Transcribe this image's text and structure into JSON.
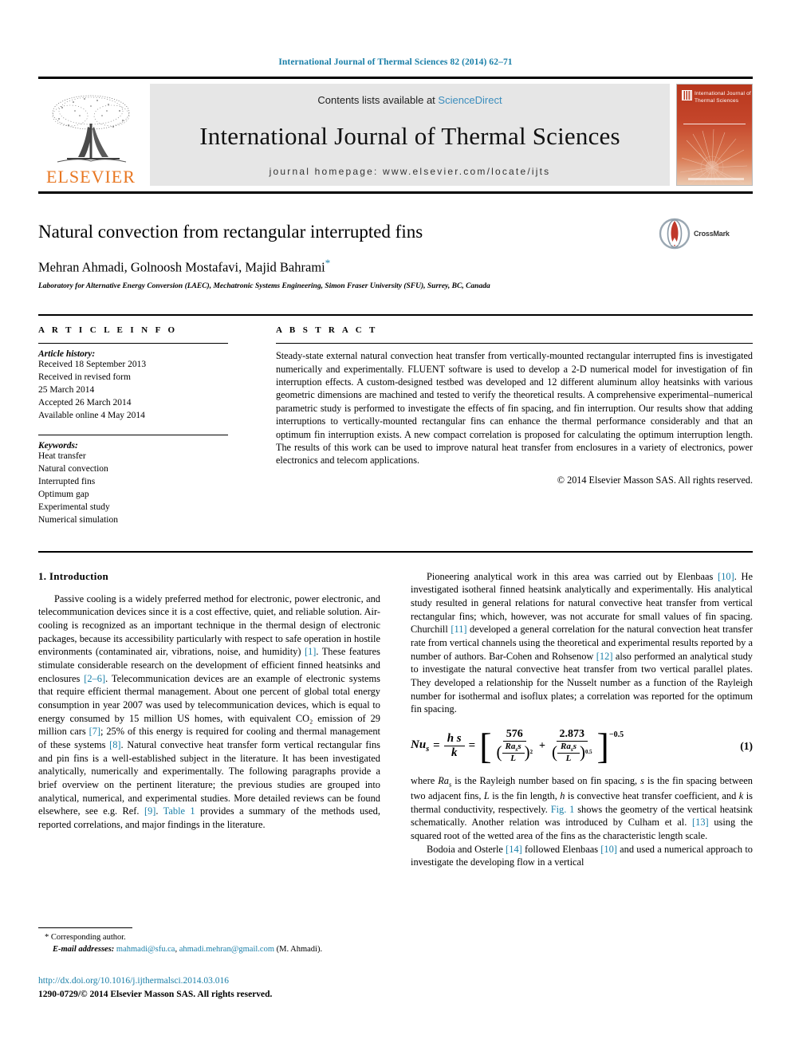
{
  "running_head": "International Journal of Thermal Sciences 82 (2014) 62–71",
  "masthead": {
    "contents_prefix": "Contents lists available at ",
    "sciencedirect": "ScienceDirect",
    "journal_name": "International Journal of Thermal Sciences",
    "homepage": "journal homepage: www.elsevier.com/locate/ijts",
    "publisher_logo_text": "ELSEVIER",
    "cover_title": "International Journal of Thermal Sciences",
    "accent_color": "#1a7fa8",
    "elsevier_orange": "#E87722",
    "cover_red": "#b8371d"
  },
  "title_block": {
    "title": "Natural convection from rectangular interrupted fins",
    "authors": "Mehran Ahmadi, Golnoosh Mostafavi, Majid Bahrami",
    "corresponding_marker": "*",
    "affiliation": "Laboratory for Alternative Energy Conversion (LAEC), Mechatronic Systems Engineering, Simon Fraser University (SFU), Surrey, BC, Canada",
    "crossmark_label": "CrossMark"
  },
  "article_info": {
    "heading": "A R T I C L E   I N F O",
    "history_label": "Article history:",
    "history": [
      "Received 18 September 2013",
      "Received in revised form",
      "25 March 2014",
      "Accepted 26 March 2014",
      "Available online 4 May 2014"
    ],
    "keywords_label": "Keywords:",
    "keywords": [
      "Heat transfer",
      "Natural convection",
      "Interrupted fins",
      "Optimum gap",
      "Experimental study",
      "Numerical simulation"
    ]
  },
  "abstract": {
    "heading": "A B S T R A C T",
    "text": "Steady-state external natural convection heat transfer from vertically-mounted rectangular interrupted fins is investigated numerically and experimentally. FLUENT software is used to develop a 2-D numerical model for investigation of fin interruption effects. A custom-designed testbed was developed and 12 different aluminum alloy heatsinks with various geometric dimensions are machined and tested to verify the theoretical results. A comprehensive experimental–numerical parametric study is performed to investigate the effects of fin spacing, and fin interruption. Our results show that adding interruptions to vertically-mounted rectangular fins can enhance the thermal performance considerably and that an optimum fin interruption exists. A new compact correlation is proposed for calculating the optimum interruption length. The results of this work can be used to improve natural heat transfer from enclosures in a variety of electronics, power electronics and telecom applications.",
    "copyright": "© 2014 Elsevier Masson SAS. All rights reserved."
  },
  "body": {
    "section_number_title": "1. Introduction",
    "left_paragraph_1_a": "Passive cooling is a widely preferred method for electronic, power electronic, and telecommunication devices since it is a cost effective, quiet, and reliable solution. Air-cooling is recognized as an important technique in the thermal design of electronic packages, because its accessibility particularly with respect to safe operation in hostile environments (contaminated air, vibrations, noise, and humidity) ",
    "ref_1": "[1]",
    "left_paragraph_1_b": ". These features stimulate considerable research on the development of efficient finned heatsinks and enclosures ",
    "ref_2_6": "[2–6]",
    "left_paragraph_1_c": ". Telecommunication devices are an example of electronic systems that require efficient thermal management. About one percent of global total energy consumption in year 2007 was used by telecommunication devices, which is equal to energy consumed by 15 million US homes, with equivalent CO₂ emission of 29 million cars ",
    "ref_7": "[7]",
    "left_paragraph_1_d": "; 25% of this energy is required for cooling and thermal management of these systems ",
    "ref_8": "[8]",
    "left_paragraph_1_e": ". Natural convective heat transfer form vertical rectangular fins and pin fins is a well-established subject in the literature. It has been investigated analytically, numerically and experimentally. The following paragraphs provide a brief overview on the pertinent literature; the previous studies are grouped into analytical, numerical, and experimental studies. More detailed reviews can be found elsewhere, see e.g. Ref. ",
    "ref_9": "[9]",
    "left_paragraph_1_f": ". ",
    "table_1_link": "Table 1",
    "left_paragraph_1_g": " provides a summary of the methods used, reported correlations, and major findings in the literature.",
    "right_paragraph_1_a": "Pioneering analytical work in this area was carried out by Elenbaas ",
    "ref_10": "[10]",
    "right_paragraph_1_b": ". He investigated isotheral finned heatsink analytically and experimentally. His analytical study resulted in general relations for natural convective heat transfer from vertical rectangular fins; which, however, was not accurate for small values of fin spacing. Churchill ",
    "ref_11": "[11]",
    "right_paragraph_1_c": " developed a general correlation for the natural convection heat transfer rate from vertical channels using the theoretical and experimental results reported by a number of authors. Bar-Cohen and Rohsenow ",
    "ref_12": "[12]",
    "right_paragraph_1_d": " also performed an analytical study to investigate the natural convective heat transfer from two vertical parallel plates. They developed a relationship for the Nusselt number as a function of the Rayleigh number for isothermal and isoflux plates; a correlation was reported for the optimum fin spacing.",
    "equation": {
      "lhs_symbol": "Nu",
      "lhs_sub": "s",
      "eq1": "=",
      "frac1_num": "h s",
      "frac1_den": "k",
      "eq2": "=",
      "term1_num": "576",
      "term1_den_paren_num": "Ra",
      "term1_den_paren_sub": "s",
      "term1_den_paren_num2": "s",
      "term1_den_paren_den": "L",
      "term1_den_exp": "2",
      "plus": "+",
      "term2_num": "2.873",
      "term2_den_paren_num": "Ra",
      "term2_den_paren_sub": "s",
      "term2_den_paren_num2": "s",
      "term2_den_paren_den": "L",
      "term2_den_exp": "0.5",
      "outer_exp": "−0.5",
      "number": "(1)"
    },
    "right_paragraph_2_a": "where ",
    "ra_s": "Ra",
    "ra_s_sub": "s",
    "right_paragraph_2_b": " is the Rayleigh number based on fin spacing, ",
    "sym_s": "s",
    "right_paragraph_2_c": " is the fin spacing between two adjacent fins, ",
    "sym_L": "L",
    "right_paragraph_2_d": " is the fin length, ",
    "sym_h": "h",
    "right_paragraph_2_e": " is convective heat transfer coefficient, and ",
    "sym_k": "k",
    "right_paragraph_2_f": " is thermal conductivity, respectively. ",
    "fig_1_link": "Fig. 1",
    "right_paragraph_2_g": " shows the geometry of the vertical heatsink schematically. Another relation was introduced by Culham et al. ",
    "ref_13": "[13]",
    "right_paragraph_2_h": " using the squared root of the wetted area of the fins as the characteristic length scale.",
    "right_paragraph_3_a": "Bodoia and Osterle ",
    "ref_14": "[14]",
    "right_paragraph_3_b": " followed Elenbaas ",
    "ref_10b": "[10]",
    "right_paragraph_3_c": " and used a numerical approach to investigate the developing flow in a vertical"
  },
  "footnote": {
    "corresponding": "* Corresponding author.",
    "email_label": "E-mail addresses:",
    "email_1": "mahmadi@sfu.ca",
    "email_sep": ", ",
    "email_2": "ahmadi.mehran@gmail.com",
    "email_owner": " (M. Ahmadi)."
  },
  "imprint": {
    "doi_url": "http://dx.doi.org/10.1016/j.ijthermalsci.2014.03.016",
    "issn_line": "1290-0729/© 2014 Elsevier Masson SAS. All rights reserved."
  }
}
